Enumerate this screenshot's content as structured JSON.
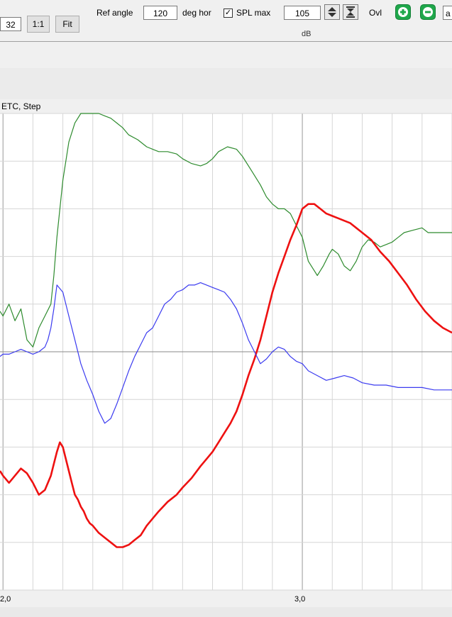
{
  "toolbar": {
    "zoom_value": "32",
    "one_to_one_label": "1:1",
    "fit_label": "Fit",
    "ref_angle_label": "Ref angle",
    "ref_angle_value": "120",
    "deg_hor_label": "deg hor",
    "spl_max_checked": true,
    "spl_max_label": "SPL max",
    "spl_max_value": "105",
    "ovl_label": "Ovl",
    "truncated_field_value": "a",
    "partial_axis_text": "dB"
  },
  "plot": {
    "title": "ETC, Step",
    "x_tick_labels": [
      "2,0",
      "3,0"
    ]
  },
  "chart_data": {
    "type": "line",
    "title": "ETC, Step",
    "xlabel": "",
    "ylabel": "",
    "xlim": [
      1.99,
      3.5
    ],
    "ylim": [
      -1,
      1
    ],
    "grid": true,
    "x_ticks": [
      2.0,
      3.0
    ],
    "series": [
      {
        "color": "#2e8b2e",
        "x": [
          1.99,
          2.0,
          2.02,
          2.04,
          2.06,
          2.08,
          2.1,
          2.12,
          2.14,
          2.16,
          2.17,
          2.18,
          2.2,
          2.22,
          2.24,
          2.26,
          2.28,
          2.29,
          2.3,
          2.31,
          2.32,
          2.34,
          2.36,
          2.38,
          2.4,
          2.42,
          2.45,
          2.48,
          2.5,
          2.52,
          2.55,
          2.58,
          2.6,
          2.63,
          2.66,
          2.68,
          2.7,
          2.72,
          2.75,
          2.78,
          2.8,
          2.83,
          2.86,
          2.88,
          2.9,
          2.92,
          2.94,
          2.96,
          2.98,
          3.0,
          3.02,
          3.05,
          3.07,
          3.09,
          3.1,
          3.12,
          3.14,
          3.16,
          3.18,
          3.2,
          3.22,
          3.24,
          3.26,
          3.28,
          3.3,
          3.32,
          3.34,
          3.37,
          3.4,
          3.42,
          3.45,
          3.48,
          3.5
        ],
        "y": [
          0.17,
          0.15,
          0.2,
          0.13,
          0.18,
          0.05,
          0.02,
          0.1,
          0.15,
          0.2,
          0.32,
          0.48,
          0.72,
          0.88,
          0.96,
          1.0,
          1.0,
          1.0,
          1.0,
          1.0,
          1.0,
          0.99,
          0.98,
          0.96,
          0.94,
          0.91,
          0.89,
          0.86,
          0.85,
          0.84,
          0.84,
          0.83,
          0.81,
          0.79,
          0.78,
          0.79,
          0.81,
          0.84,
          0.86,
          0.85,
          0.82,
          0.76,
          0.7,
          0.65,
          0.62,
          0.6,
          0.6,
          0.58,
          0.53,
          0.48,
          0.38,
          0.32,
          0.36,
          0.41,
          0.43,
          0.41,
          0.36,
          0.34,
          0.38,
          0.44,
          0.47,
          0.46,
          0.44,
          0.45,
          0.46,
          0.48,
          0.5,
          0.51,
          0.52,
          0.5,
          0.5,
          0.5,
          0.5
        ]
      },
      {
        "color": "#ee1111",
        "x": [
          1.99,
          2.0,
          2.02,
          2.04,
          2.06,
          2.08,
          2.1,
          2.12,
          2.14,
          2.16,
          2.17,
          2.18,
          2.19,
          2.2,
          2.21,
          2.22,
          2.23,
          2.24,
          2.25,
          2.26,
          2.27,
          2.28,
          2.29,
          2.3,
          2.32,
          2.34,
          2.36,
          2.38,
          2.4,
          2.42,
          2.44,
          2.46,
          2.48,
          2.5,
          2.52,
          2.55,
          2.58,
          2.6,
          2.63,
          2.66,
          2.68,
          2.7,
          2.72,
          2.74,
          2.76,
          2.78,
          2.8,
          2.82,
          2.84,
          2.86,
          2.88,
          2.9,
          2.92,
          2.94,
          2.96,
          2.98,
          3.0,
          3.02,
          3.04,
          3.06,
          3.08,
          3.1,
          3.12,
          3.14,
          3.16,
          3.18,
          3.2,
          3.23,
          3.26,
          3.29,
          3.32,
          3.35,
          3.38,
          3.41,
          3.44,
          3.47,
          3.5
        ],
        "y": [
          -0.5,
          -0.52,
          -0.55,
          -0.52,
          -0.49,
          -0.51,
          -0.55,
          -0.6,
          -0.58,
          -0.52,
          -0.47,
          -0.42,
          -0.38,
          -0.4,
          -0.45,
          -0.5,
          -0.55,
          -0.6,
          -0.62,
          -0.65,
          -0.67,
          -0.7,
          -0.72,
          -0.73,
          -0.76,
          -0.78,
          -0.8,
          -0.82,
          -0.82,
          -0.81,
          -0.79,
          -0.77,
          -0.73,
          -0.7,
          -0.67,
          -0.63,
          -0.6,
          -0.57,
          -0.53,
          -0.48,
          -0.45,
          -0.42,
          -0.38,
          -0.34,
          -0.3,
          -0.25,
          -0.18,
          -0.1,
          -0.03,
          0.05,
          0.15,
          0.25,
          0.33,
          0.4,
          0.47,
          0.53,
          0.6,
          0.62,
          0.62,
          0.6,
          0.58,
          0.57,
          0.56,
          0.55,
          0.54,
          0.52,
          0.5,
          0.47,
          0.42,
          0.38,
          0.33,
          0.28,
          0.22,
          0.17,
          0.13,
          0.1,
          0.08
        ]
      },
      {
        "color": "#3b3bf0",
        "x": [
          1.99,
          2.0,
          2.02,
          2.04,
          2.06,
          2.08,
          2.1,
          2.12,
          2.14,
          2.15,
          2.16,
          2.17,
          2.18,
          2.2,
          2.22,
          2.24,
          2.26,
          2.28,
          2.3,
          2.32,
          2.34,
          2.36,
          2.38,
          2.4,
          2.42,
          2.44,
          2.46,
          2.48,
          2.5,
          2.52,
          2.54,
          2.56,
          2.58,
          2.6,
          2.62,
          2.64,
          2.66,
          2.68,
          2.7,
          2.72,
          2.74,
          2.76,
          2.78,
          2.8,
          2.82,
          2.84,
          2.86,
          2.88,
          2.9,
          2.92,
          2.94,
          2.96,
          2.98,
          3.0,
          3.02,
          3.05,
          3.08,
          3.11,
          3.14,
          3.17,
          3.2,
          3.24,
          3.28,
          3.32,
          3.36,
          3.4,
          3.44,
          3.48,
          3.5
        ],
        "y": [
          -0.02,
          -0.01,
          -0.01,
          0,
          0.01,
          0,
          -0.01,
          0,
          0.02,
          0.05,
          0.1,
          0.18,
          0.28,
          0.25,
          0.15,
          0.05,
          -0.05,
          -0.12,
          -0.18,
          -0.25,
          -0.3,
          -0.28,
          -0.22,
          -0.15,
          -0.08,
          -0.02,
          0.03,
          0.08,
          0.1,
          0.15,
          0.2,
          0.22,
          0.25,
          0.26,
          0.28,
          0.28,
          0.29,
          0.28,
          0.27,
          0.26,
          0.25,
          0.22,
          0.18,
          0.12,
          0.05,
          0,
          -0.05,
          -0.03,
          0,
          0.02,
          0.01,
          -0.02,
          -0.04,
          -0.05,
          -0.08,
          -0.1,
          -0.12,
          -0.11,
          -0.1,
          -0.11,
          -0.13,
          -0.14,
          -0.14,
          -0.15,
          -0.15,
          -0.15,
          -0.16,
          -0.16,
          -0.16
        ]
      }
    ]
  }
}
